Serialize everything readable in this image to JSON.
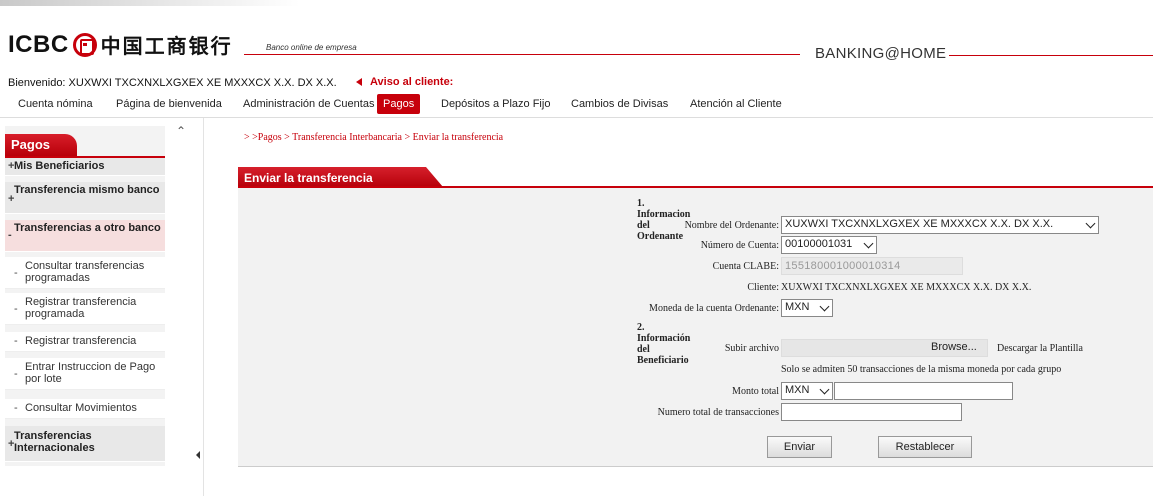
{
  "header": {
    "logo_text": "ICBC",
    "logo_cn": "中国工商银行",
    "tagline": "Banco online de empresa",
    "brand": "BANKING@HOME"
  },
  "welcome": "Bienvenido: XUXWXI TXCXNXLXGXEX XE MXXXCX X.X. DX X.X.",
  "notice": "Aviso al cliente:",
  "nav": [
    "Cuenta nómina",
    "Página de bienvenida",
    "Administración de Cuentas",
    "Pagos",
    "Depósitos a Plazo Fijo",
    "Cambios de Divisas",
    "Atención al Cliente"
  ],
  "sidebar": {
    "title": "Pagos",
    "items": [
      {
        "prefix": "+",
        "label": "Mis Beneficiarios"
      },
      {
        "prefix": "+",
        "label": "Transferencia mismo banco"
      },
      {
        "prefix": "-",
        "label": "Transferencias a otro banco"
      },
      {
        "prefix": "-",
        "label": "Consultar transferencias programadas"
      },
      {
        "prefix": "-",
        "label": "Registrar transferencia programada"
      },
      {
        "prefix": "-",
        "label": "Registrar transferencia"
      },
      {
        "prefix": "-",
        "label": "Entrar Instruccion de Pago por lote"
      },
      {
        "prefix": "-",
        "label": "Consultar Movimientos"
      },
      {
        "prefix": "+",
        "label": "Transferencias Internacionales"
      }
    ]
  },
  "breadcrumb": "> >Pagos > Transferencia Interbancaria > Enviar la transferencia",
  "panel": {
    "title": "Enviar la transferencia",
    "section1": "1. Informacion del Ordenante",
    "section2": "2. Información del Beneficiario",
    "nombre_label": "Nombre del Ordenante:",
    "nombre_value": "XUXWXI TXCXNXLXGXEX XE MXXXCX X.X. DX X.X.",
    "numero_label": "Número de Cuenta:",
    "numero_value": "00100001031",
    "clabe_label": "Cuenta CLABE:",
    "clabe_value": "155180001000010314",
    "cliente_label": "Cliente:",
    "cliente_value": "XUXWXI TXCXNXLXGXEX XE MXXXCX X.X. DX X.X.",
    "moneda_label": "Moneda de la cuenta Ordenante:",
    "moneda_value": "MXN",
    "subir_label": "Subir archivo",
    "browse_label": "Browse...",
    "descargar": "Descargar la Plantilla",
    "note": "Solo se admiten 50 transacciones de la misma moneda por cada grupo",
    "monto_label": "Monto total",
    "monto_currency": "MXN",
    "numero_trans_label": "Numero total de transacciones",
    "enviar": "Enviar",
    "restablecer": "Restablecer"
  }
}
